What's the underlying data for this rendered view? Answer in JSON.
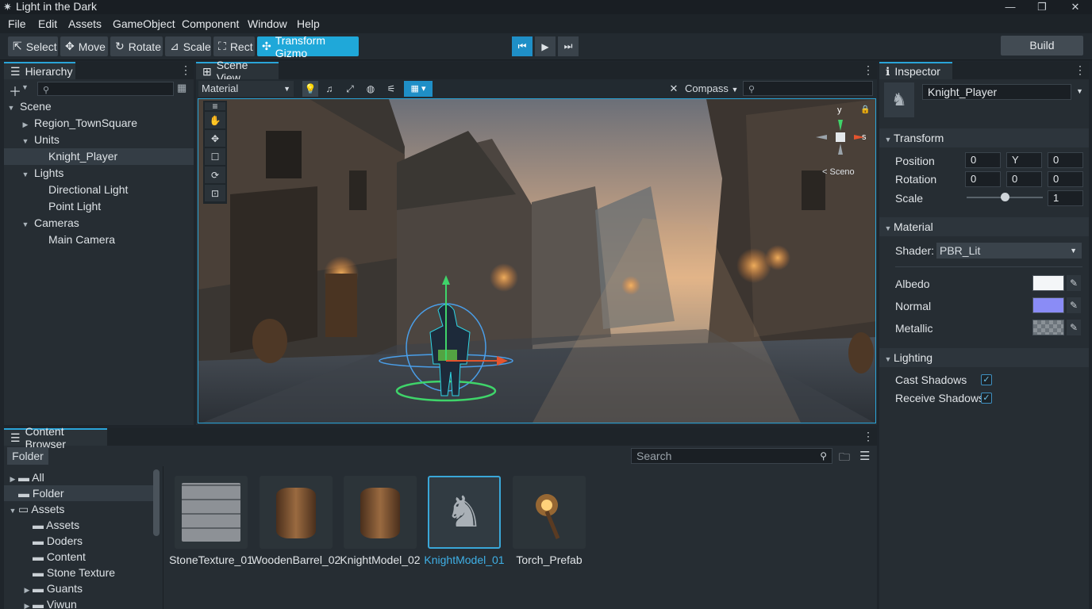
{
  "window": {
    "title": "Light in the Dark"
  },
  "menu": [
    "File",
    "Edit",
    "Assets",
    "GameObject",
    "Component",
    "Window",
    "Help"
  ],
  "toolbar": {
    "tools": [
      {
        "label": "Select",
        "icon": "cursor-icon"
      },
      {
        "label": "Move",
        "icon": "move-icon"
      },
      {
        "label": "Rotate",
        "icon": "rotate-icon"
      },
      {
        "label": "Scale",
        "icon": "scale-icon"
      },
      {
        "label": "Rect",
        "icon": "rect-icon"
      },
      {
        "label": "Transform Gizmo",
        "icon": "transform-gizmo-icon",
        "active": true
      }
    ],
    "build_label": "Build"
  },
  "hierarchy": {
    "tab": "Hierarchy",
    "search_placeholder": "",
    "items": [
      {
        "label": "Scene"
      },
      {
        "label": "Region_TownSquare"
      },
      {
        "label": "Units"
      },
      {
        "label": "Knight_Player",
        "selected": true
      },
      {
        "label": "Lights"
      },
      {
        "label": "Directional Light"
      },
      {
        "label": "Point Light"
      },
      {
        "label": "Cameras"
      },
      {
        "label": "Main Camera"
      }
    ]
  },
  "scene": {
    "tab": "Scene View",
    "shading_mode": "Material",
    "compass_label": "Compass",
    "gizmo_labels": {
      "y": "y",
      "s": "s",
      "scene": "< Sceno"
    }
  },
  "inspector": {
    "tab": "Inspector",
    "object_name": "Knight_Player",
    "transform": {
      "title": "Transform",
      "position_label": "Position",
      "position": [
        "0",
        "Y",
        "0"
      ],
      "rotation_label": "Rotation",
      "rotation": [
        "0",
        "0",
        "0"
      ],
      "scale_label": "Scale",
      "scale_value": "1",
      "scale_slider_fraction": 0.5
    },
    "material": {
      "title": "Material",
      "shader_label": "Shader:",
      "shader_value": "PBR_Lit",
      "albedo_label": "Albedo",
      "normal_label": "Normal",
      "metallic_label": "Metallic",
      "albedo_color": "#f4f6f8",
      "normal_color": "#8a8cf6"
    },
    "lighting": {
      "title": "Lighting",
      "cast_shadows_label": "Cast Shadows",
      "receive_shadows_label": "Receive Shadows",
      "cast_shadows": true,
      "receive_shadows": true
    }
  },
  "content_browser": {
    "tab": "Content Browser",
    "folder_button": "Folder",
    "search_placeholder": "Search",
    "tree": [
      {
        "label": "All"
      },
      {
        "label": "Folder",
        "selected": true
      },
      {
        "label": "Assets"
      },
      {
        "label": "Assets"
      },
      {
        "label": "Doders"
      },
      {
        "label": "Content"
      },
      {
        "label": "Stone Texture"
      },
      {
        "label": "Guants"
      },
      {
        "label": "Viwun"
      }
    ],
    "assets": [
      {
        "label": "StoneTexture_01",
        "kind": "stone-texture-thumbnail"
      },
      {
        "label": "WoodenBarrel_02",
        "kind": "barrel-thumbnail"
      },
      {
        "label": "KnightModel_02",
        "kind": "barrel-thumbnail"
      },
      {
        "label": "KnightModel_01",
        "kind": "knight-thumbnail",
        "selected": true
      },
      {
        "label": "Torch_Prefab",
        "kind": "torch-thumbnail"
      }
    ]
  },
  "colors": {
    "accent": "#1fa8d9",
    "selection_text": "#3fb0e6",
    "panel": "#262d33"
  }
}
